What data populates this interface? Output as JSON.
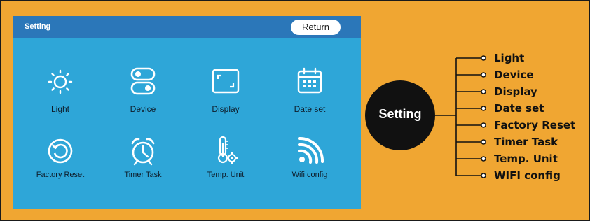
{
  "screen": {
    "title": "Setting",
    "return_label": "Return",
    "tiles": [
      {
        "label": "Light",
        "icon": "sun-icon"
      },
      {
        "label": "Device",
        "icon": "toggle-switches-icon"
      },
      {
        "label": "Display",
        "icon": "display-frame-icon"
      },
      {
        "label": "Date set",
        "icon": "calendar-icon"
      },
      {
        "label": "Factory Reset",
        "icon": "reset-arrow-icon"
      },
      {
        "label": "Timer Task",
        "icon": "alarm-clock-icon"
      },
      {
        "label": "Temp. Unit",
        "icon": "thermometer-gear-icon"
      },
      {
        "label": "Wifi config",
        "icon": "wifi-icon"
      }
    ]
  },
  "diagram": {
    "hub_label": "Setting",
    "items": [
      "Light",
      "Device",
      "Display",
      "Date set",
      "Factory Reset",
      "Timer Task",
      "Temp. Unit",
      "WIFI config"
    ]
  },
  "colors": {
    "background": "#F0A632",
    "screen": "#2EA6D8",
    "titlebar": "#2B77B9",
    "hub": "#111111"
  }
}
